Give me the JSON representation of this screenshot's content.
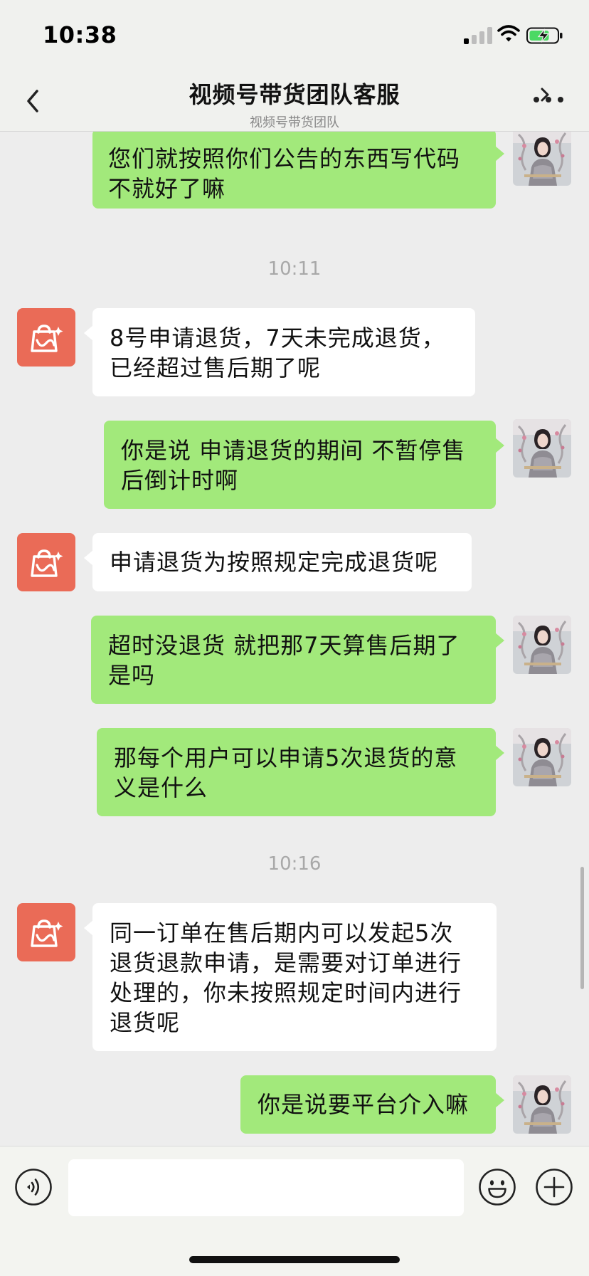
{
  "status_bar": {
    "time": "10:38",
    "icons": [
      "signal-icon",
      "wifi-icon",
      "battery-charging-icon"
    ]
  },
  "header": {
    "title": "视频号带货团队客服",
    "subtitle": "视频号带货团队",
    "icons": [
      "back-icon",
      "chevron-right-icon",
      "more-icon"
    ]
  },
  "messages": [
    {
      "type": "sent",
      "text": "您们就按照你们公告的东西写代码\n不就好了嘛"
    },
    {
      "type": "timestamp",
      "text": "10:11"
    },
    {
      "type": "received",
      "text": "8号申请退货，7天未完成退货，\n已经超过售后期了呢"
    },
    {
      "type": "sent",
      "text": "你是说 申请退货的期间 不暂停售\n后倒计时啊"
    },
    {
      "type": "received",
      "text": "申请退货为按照规定完成退货呢"
    },
    {
      "type": "sent",
      "text": "超时没退货 就把那7天算售后期了\n是吗"
    },
    {
      "type": "sent",
      "text": "那每个用户可以申请5次退货的意\n义是什么"
    },
    {
      "type": "timestamp",
      "text": "10:16"
    },
    {
      "type": "received",
      "text": "同一订单在售后期内可以发起5次\n退货退款申请，是需要对订单进行\n处理的，你未按照规定时间内进行\n退货呢"
    },
    {
      "type": "sent",
      "text": "你是说要平台介入嘛"
    }
  ],
  "input_bar": {
    "value": "",
    "icons": [
      "voice-icon",
      "emoji-icon",
      "plus-icon"
    ]
  },
  "colors": {
    "sent_bubble": "#a2e97b",
    "received_bubble": "#ffffff",
    "service_avatar": "#ea6b57",
    "chat_background": "#ededed"
  }
}
